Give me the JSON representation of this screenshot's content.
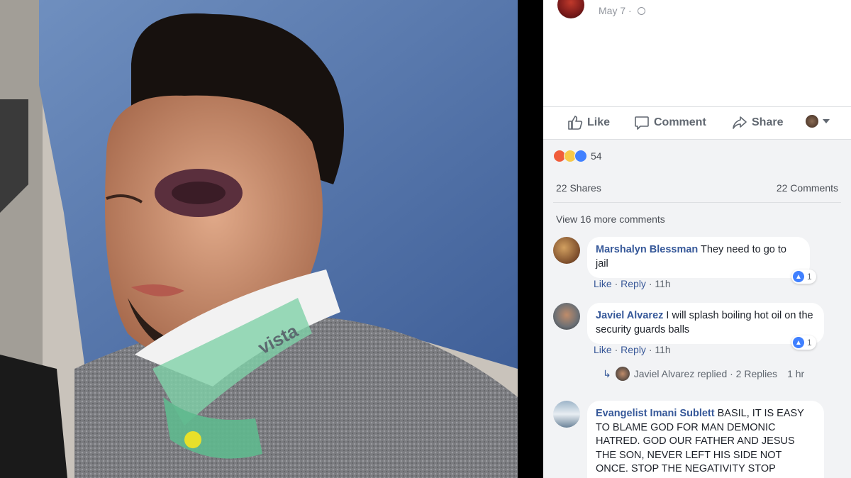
{
  "post": {
    "date": "May 7",
    "separator": "·"
  },
  "actions": {
    "like_label": "Like",
    "comment_label": "Comment",
    "share_label": "Share"
  },
  "reactions": {
    "count": "54",
    "types": [
      "angry",
      "sad",
      "like"
    ]
  },
  "stats": {
    "shares": "22 Shares",
    "comments": "22 Comments"
  },
  "view_more": "View 16 more comments",
  "comments": [
    {
      "author": "Marshalyn Blessman",
      "text": "They need to go to jail",
      "like_label": "Like",
      "reply_label": "Reply",
      "time": "11h",
      "likes": "1"
    },
    {
      "author": "Javiel Alvarez",
      "text": "I will splash boiling hot oil on the security guards balls",
      "like_label": "Like",
      "reply_label": "Reply",
      "time": "11h",
      "likes": "1",
      "reply_summary": {
        "text": "Javiel Alvarez replied · 2 Replies",
        "time": "1 hr"
      }
    },
    {
      "author": "Evangelist Imani Sublett",
      "text": "BASIL, IT IS EASY TO BLAME GOD FOR MAN DEMONIC HATRED. GOD OUR FATHER AND JESUS THE SON, NEVER LEFT HIS SIDE NOT ONCE. STOP THE NEGATIVITY STOP BLAMING GOD"
    }
  ],
  "colors": {
    "link_blue": "#365899",
    "muted": "#90949c",
    "feedback_bg": "#f2f3f5",
    "like_blue": "#4080ff"
  }
}
